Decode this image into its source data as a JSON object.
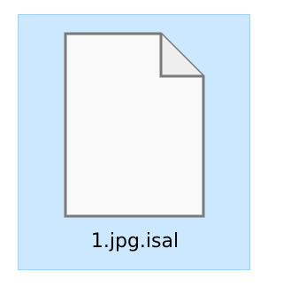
{
  "file": {
    "name": "1.jpg.isal",
    "icon": "blank-document-icon",
    "selected": true
  },
  "colors": {
    "selection_background": "#cce8ff",
    "selection_border": "#99d1ff",
    "document_fill": "#f9f9f9",
    "document_outline": "#7a7a7a"
  }
}
